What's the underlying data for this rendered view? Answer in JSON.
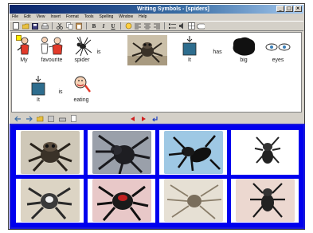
{
  "window": {
    "title": "Writing Symbols - [spiders]",
    "controls": [
      "_",
      "□",
      "×"
    ]
  },
  "menu": [
    "File",
    "Edit",
    "View",
    "Insert",
    "Format",
    "Tools",
    "Spelling",
    "Window",
    "Help"
  ],
  "toolbar": {
    "bold": "B",
    "italic": "I",
    "underline": "U",
    "icons": [
      "new-icon",
      "open-icon",
      "save-icon",
      "print-icon",
      "cut-icon",
      "copy-icon",
      "paste-icon",
      "bold-icon",
      "italic-icon",
      "underline-icon",
      "symbol-icon",
      "align-left-icon",
      "align-center-icon",
      "align-right-icon",
      "list-icon",
      "speak-icon",
      "grid-icon"
    ]
  },
  "sentence1": {
    "words": [
      "My",
      "favourite",
      "spider",
      "is",
      "",
      "It",
      "has",
      "big",
      "eyes"
    ]
  },
  "sentence2": {
    "words": [
      "It",
      "is",
      "eating"
    ]
  },
  "status": {
    "icons": [
      "back-icon",
      "forward-icon",
      "folder-icon",
      "disk-icon",
      "print-icon",
      "page-icon",
      "left-arrow-icon",
      "right-arrow-icon",
      "return-icon"
    ]
  },
  "grid": {
    "cells": [
      {
        "label": "jumping spider",
        "bg": "#cfc8b8"
      },
      {
        "label": "hairy spider",
        "bg": "#9aa0aa"
      },
      {
        "label": "black spider",
        "bg": "#9ec8e4"
      },
      {
        "label": "small spider",
        "bg": "#ffffff"
      },
      {
        "label": "striped spider",
        "bg": "#dcd4c4"
      },
      {
        "label": "red-black spider",
        "bg": "#e8c8c8"
      },
      {
        "label": "pale spider",
        "bg": "#e6e0d4"
      },
      {
        "label": "dark spider",
        "bg": "#ecd8d0"
      }
    ]
  },
  "colors": {
    "grid_border": "#0000ee",
    "window_bg": "#d4d0c8",
    "title_start": "#0a246a"
  }
}
